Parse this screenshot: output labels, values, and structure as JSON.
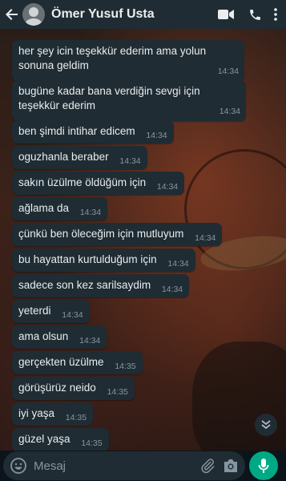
{
  "header": {
    "contact_name": "Ömer Yusuf Usta",
    "icons": [
      "back-arrow-icon",
      "video-call-icon",
      "phone-icon",
      "more-options-icon"
    ]
  },
  "messages": [
    {
      "text": "her şey icin teşekkür ederim ama yolun sonuna geldim",
      "time": "14:34"
    },
    {
      "text": "bugüne kadar bana verdiğin sevgi için teşekkür ederim",
      "time": "14:34"
    },
    {
      "text": "ben şimdi intihar edicem",
      "time": "14:34"
    },
    {
      "text": "oguzhanla beraber",
      "time": "14:34"
    },
    {
      "text": "sakın üzülme öldüğüm için",
      "time": "14:34"
    },
    {
      "text": "ağlama da",
      "time": "14:34"
    },
    {
      "text": "çünkü ben öleceğim için mutluyum",
      "time": "14:34"
    },
    {
      "text": "bu hayattan kurtulduğum için",
      "time": "14:34"
    },
    {
      "text": "sadece son kez sarilsaydim",
      "time": "14:34"
    },
    {
      "text": "yeterdi",
      "time": "14:34"
    },
    {
      "text": "ama olsun",
      "time": "14:34"
    },
    {
      "text": "gerçekten üzülme",
      "time": "14:35"
    },
    {
      "text": "görüşürüz neido",
      "time": "14:35"
    },
    {
      "text": "iyi yaşa",
      "time": "14:35"
    },
    {
      "text": "güzel yaşa",
      "time": "14:35"
    }
  ],
  "input": {
    "placeholder": "Mesaj",
    "value": ""
  },
  "colors": {
    "header_bg": "#1f2c33",
    "bubble_bg": "#1f2c33",
    "accent": "#00a884",
    "text": "#e9edef",
    "time_text": "#8696a0"
  }
}
